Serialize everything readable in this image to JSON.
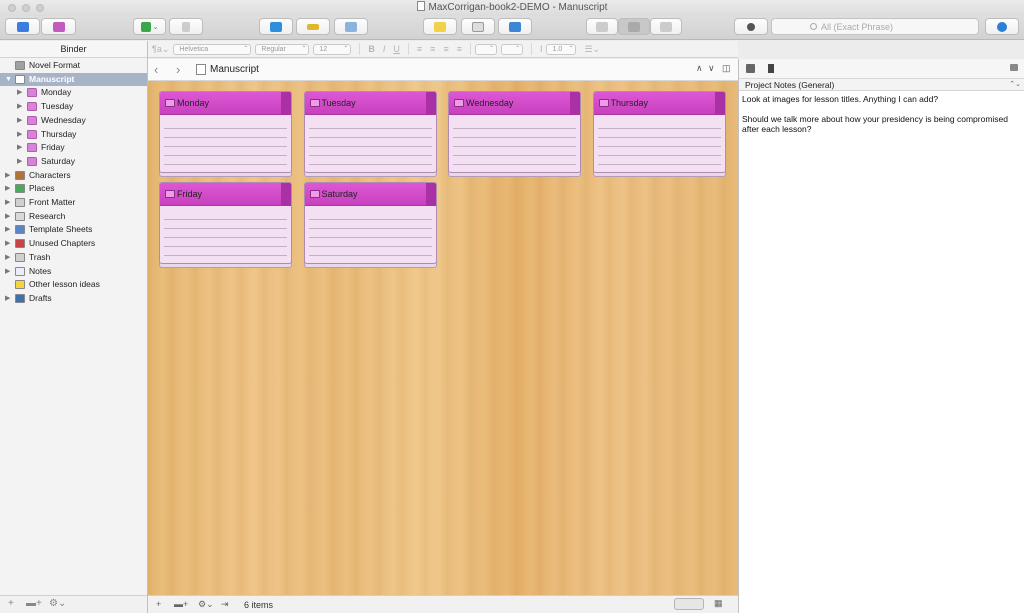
{
  "window": {
    "title": "MaxCorrigan-book2-DEMO - Manuscript"
  },
  "search": {
    "placeholder": "All (Exact Phrase)"
  },
  "formatbar": {
    "font": "Helvetica",
    "style": "Regular",
    "size": "12",
    "line_spacing": "1.0"
  },
  "binder": {
    "header": "Binder",
    "items": [
      {
        "label": "Novel Format",
        "icon": "warning-icon",
        "level": 0,
        "disclosure": ""
      },
      {
        "label": "Manuscript",
        "icon": "manuscript-icon",
        "level": 0,
        "disclosure": "▼",
        "selected": true
      },
      {
        "label": "Monday",
        "icon": "folder-icon",
        "level": 1,
        "disclosure": "▶"
      },
      {
        "label": "Tuesday",
        "icon": "folder-icon",
        "level": 1,
        "disclosure": "▶"
      },
      {
        "label": "Wednesday",
        "icon": "folder-icon",
        "level": 1,
        "disclosure": "▶"
      },
      {
        "label": "Thursday",
        "icon": "folder-icon",
        "level": 1,
        "disclosure": "▶"
      },
      {
        "label": "Friday",
        "icon": "folder-icon",
        "level": 1,
        "disclosure": "▶"
      },
      {
        "label": "Saturday",
        "icon": "folder-icon",
        "level": 1,
        "disclosure": "▶"
      },
      {
        "label": "Characters",
        "icon": "characters-icon",
        "level": 0,
        "disclosure": "▶"
      },
      {
        "label": "Places",
        "icon": "places-icon",
        "level": 0,
        "disclosure": "▶"
      },
      {
        "label": "Front Matter",
        "icon": "front-matter-icon",
        "level": 0,
        "disclosure": "▶"
      },
      {
        "label": "Research",
        "icon": "research-icon",
        "level": 0,
        "disclosure": "▶"
      },
      {
        "label": "Template Sheets",
        "icon": "template-icon",
        "level": 0,
        "disclosure": "▶"
      },
      {
        "label": "Unused Chapters",
        "icon": "book-icon",
        "level": 0,
        "disclosure": "▶"
      },
      {
        "label": "Trash",
        "icon": "trash-icon",
        "level": 0,
        "disclosure": "▶"
      },
      {
        "label": "Notes",
        "icon": "notes-icon",
        "level": 0,
        "disclosure": "▶"
      },
      {
        "label": "Other lesson ideas",
        "icon": "lightbulb-icon",
        "level": 0,
        "disclosure": ""
      },
      {
        "label": "Drafts",
        "icon": "drafts-icon",
        "level": 0,
        "disclosure": "▶"
      }
    ]
  },
  "editor": {
    "title": "Manuscript",
    "cards": [
      "Monday",
      "Tuesday",
      "Wednesday",
      "Thursday",
      "Friday",
      "Saturday"
    ],
    "footer_count": "6 items"
  },
  "inspector": {
    "notes_selector": "Project Notes (General)",
    "notes_text": "Look at images for lesson titles. Anything I can add?\n\nShould we talk more about how your presidency is being compromised after each lesson?"
  },
  "colors": {
    "card_header": "#d44ecc",
    "card_body": "#f3e1f3",
    "selection": "#a7b4c8",
    "cork_wood": "#e9bb79"
  }
}
